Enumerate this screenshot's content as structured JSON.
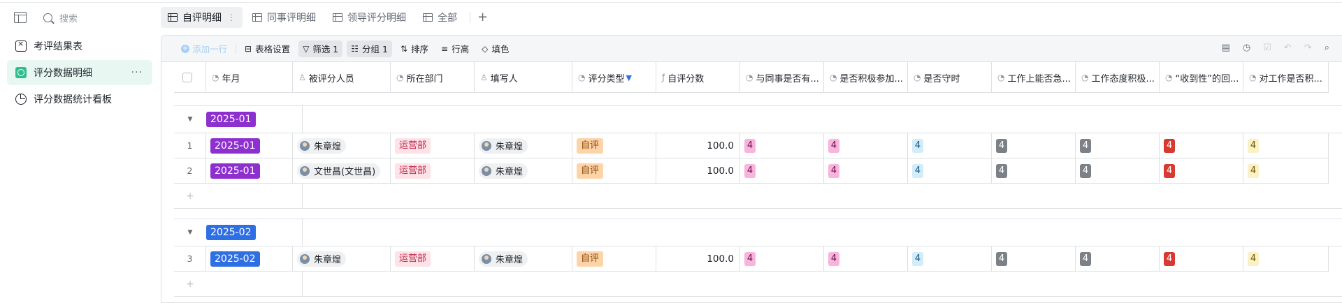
{
  "sidebar": {
    "search_placeholder": "搜索",
    "items": [
      {
        "label": "考评结果表",
        "icon": "result-table-icon"
      },
      {
        "label": "评分数据明细",
        "icon": "data-table-icon",
        "active": true
      },
      {
        "label": "评分数据统计看板",
        "icon": "dashboard-icon"
      }
    ],
    "more": "···"
  },
  "tabs": [
    {
      "label": "自评明细",
      "active": true
    },
    {
      "label": "同事评明细"
    },
    {
      "label": "领导评分明细"
    },
    {
      "label": "全部"
    }
  ],
  "tab_add": "+",
  "toolbar": {
    "add_row": "添加一行",
    "table_settings": "表格设置",
    "filter": "筛选 1",
    "group": "分组 1",
    "sort": "排序",
    "row_height": "行高",
    "fill_color": "填色"
  },
  "columns": [
    "年月",
    "被评分人员",
    "所在部门",
    "填写人",
    "评分类型",
    "自评分数",
    "与同事是否有...",
    "是否积极参加...",
    "是否守时",
    "工作上能否急...",
    "工作态度积极...",
    "“收到性”的回...",
    "对工作是否积..."
  ],
  "groups": [
    {
      "label": "2025-01",
      "rows": [
        {
          "n": "1",
          "ym": "2025-01",
          "person": "朱章煌",
          "dept": "运营部",
          "filler": "朱章煌",
          "type": "自评",
          "score": "100.0",
          "s": [
            "4",
            "4",
            "4",
            "4",
            "4",
            "4",
            "4"
          ]
        },
        {
          "n": "2",
          "ym": "2025-01",
          "person": "文世昌(文世昌)",
          "dept": "运营部",
          "filler": "朱章煌",
          "type": "自评",
          "score": "100.0",
          "s": [
            "4",
            "4",
            "4",
            "4",
            "4",
            "4",
            "4"
          ]
        }
      ]
    },
    {
      "label": "2025-02",
      "rows": [
        {
          "n": "3",
          "ym": "2025-02",
          "person": "朱章煌",
          "dept": "运营部",
          "filler": "朱章煌",
          "type": "自评",
          "score": "100.0",
          "s": [
            "4",
            "4",
            "4",
            "4",
            "4",
            "4",
            "4"
          ]
        }
      ]
    }
  ],
  "add_symbol": "+",
  "colors": {
    "accent": "#2fbf8f",
    "ym_2025_01": "#8e2fd0",
    "ym_2025_02": "#2f6fe4",
    "filter_icon": "#2f6fe4"
  }
}
